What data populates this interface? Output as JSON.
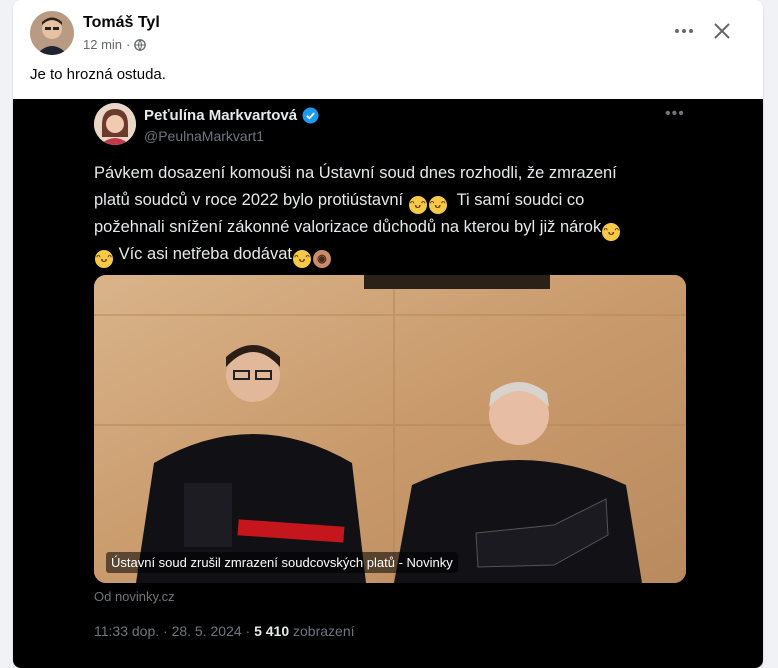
{
  "post": {
    "author": "Tomáš Tyl",
    "time": "12 min",
    "privacy_icon": "globe-icon",
    "text": "Je to hrozná ostuda."
  },
  "tweet": {
    "name": "Peťulína Markvartová",
    "handle": "@PeulnaMarkvart1",
    "verified_icon": "verified-badge-icon",
    "text_lines": [
      "Pávkem dosazení komouši na Ústavní soud dnes rozhodli,  že zmrazení",
      "platů soudců v roce 2022 bylo protiústavní",
      "Ti samí soudci co",
      "požehnali snížení zákonné valorizace důchodů na kterou byl již nárok",
      "Víc asi netřeba dodávat"
    ],
    "caption": "Ústavní soud zrušil zmrazení soudcovských platů - Novinky",
    "source": "Od novinky.cz",
    "timestamp": "11:33 dop. · 28. 5. 2024 · ",
    "views": "5 410",
    "views_label": " zobrazení"
  },
  "colors": {
    "accent": "#1d9bf0",
    "embed_bg": "#000000",
    "card_bg": "#ffffff"
  }
}
